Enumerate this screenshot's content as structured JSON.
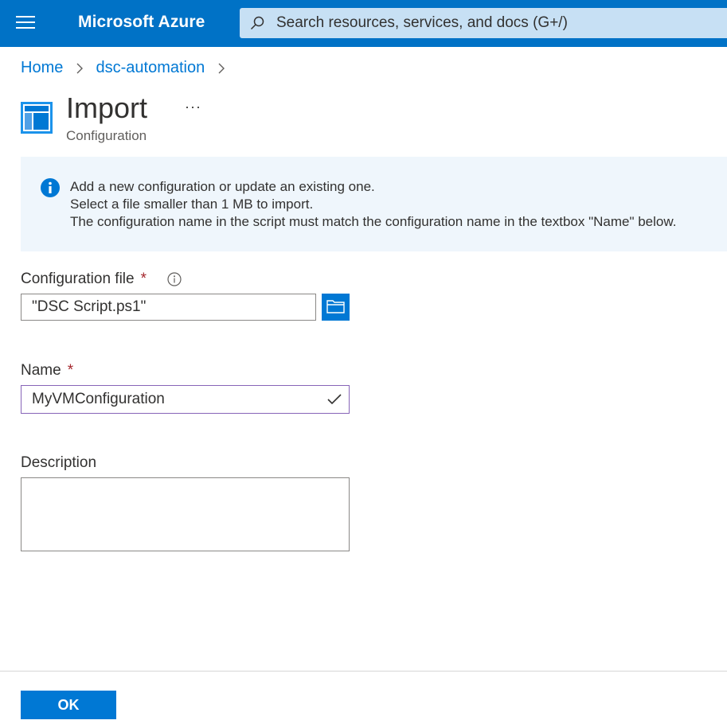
{
  "topbar": {
    "brand": "Microsoft Azure",
    "search_placeholder": "Search resources, services, and docs (G+/)"
  },
  "breadcrumb": {
    "items": [
      "Home",
      "dsc-automation"
    ]
  },
  "header": {
    "title": "Import",
    "more": "···",
    "subtitle": "Configuration"
  },
  "banner": {
    "lines": [
      "Add a new configuration or update an existing one.",
      "Select a file smaller than 1 MB to import.",
      "The configuration name in the script must match the configuration name in the textbox \"Name\" below."
    ]
  },
  "form": {
    "config_file": {
      "label": "Configuration file",
      "required": "*",
      "value": "\"DSC Script.ps1\""
    },
    "name": {
      "label": "Name",
      "required": "*",
      "value": "MyVMConfiguration"
    },
    "description": {
      "label": "Description",
      "value": ""
    }
  },
  "footer": {
    "ok_label": "OK"
  },
  "colors": {
    "topbar": "#0072c6",
    "accent": "#0078d4",
    "banner_bg": "#eff6fc",
    "required": "#a4262c",
    "focus_border": "#8764b8"
  }
}
